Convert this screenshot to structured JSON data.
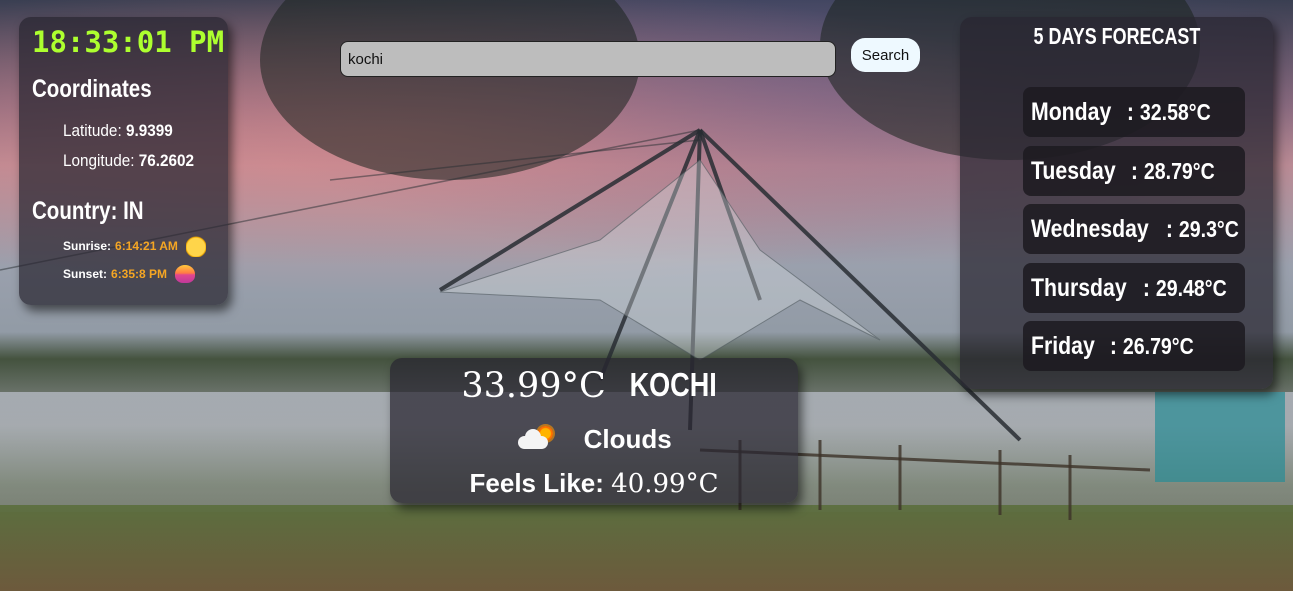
{
  "clock": {
    "time": "18:33:01 PM"
  },
  "location": {
    "coordinates_heading": "Coordinates",
    "latitude_label": "Latitude:",
    "latitude_value": "9.9399",
    "longitude_label": "Longitude:",
    "longitude_value": "76.2602",
    "country_text": "Country: IN",
    "sunrise_label": "Sunrise:",
    "sunrise_value": "6:14:21 AM",
    "sunset_label": "Sunset:",
    "sunset_value": "6:35:8 PM"
  },
  "search": {
    "value": "kochi",
    "button_label": "Search"
  },
  "forecast": {
    "title": "5 DAYS FORECAST",
    "days": [
      {
        "day": "Monday",
        "temp": "32.58°C"
      },
      {
        "day": "Tuesday",
        "temp": "28.79°C"
      },
      {
        "day": "Wednesday",
        "temp": "29.3°C"
      },
      {
        "day": "Thursday",
        "temp": "29.48°C"
      },
      {
        "day": "Friday",
        "temp": "26.79°C"
      }
    ]
  },
  "current": {
    "temperature": "33.99°C",
    "city": "KOCHI",
    "condition": "Clouds",
    "condition_icon": "cloud-sun-icon",
    "feels_like_label": "Feels Like:",
    "feels_like_value": "40.99°C"
  },
  "colors": {
    "clock": "#adff2f",
    "sun_time": "#f5a623",
    "panel_bg": "rgba(40,38,48,0.72)"
  }
}
